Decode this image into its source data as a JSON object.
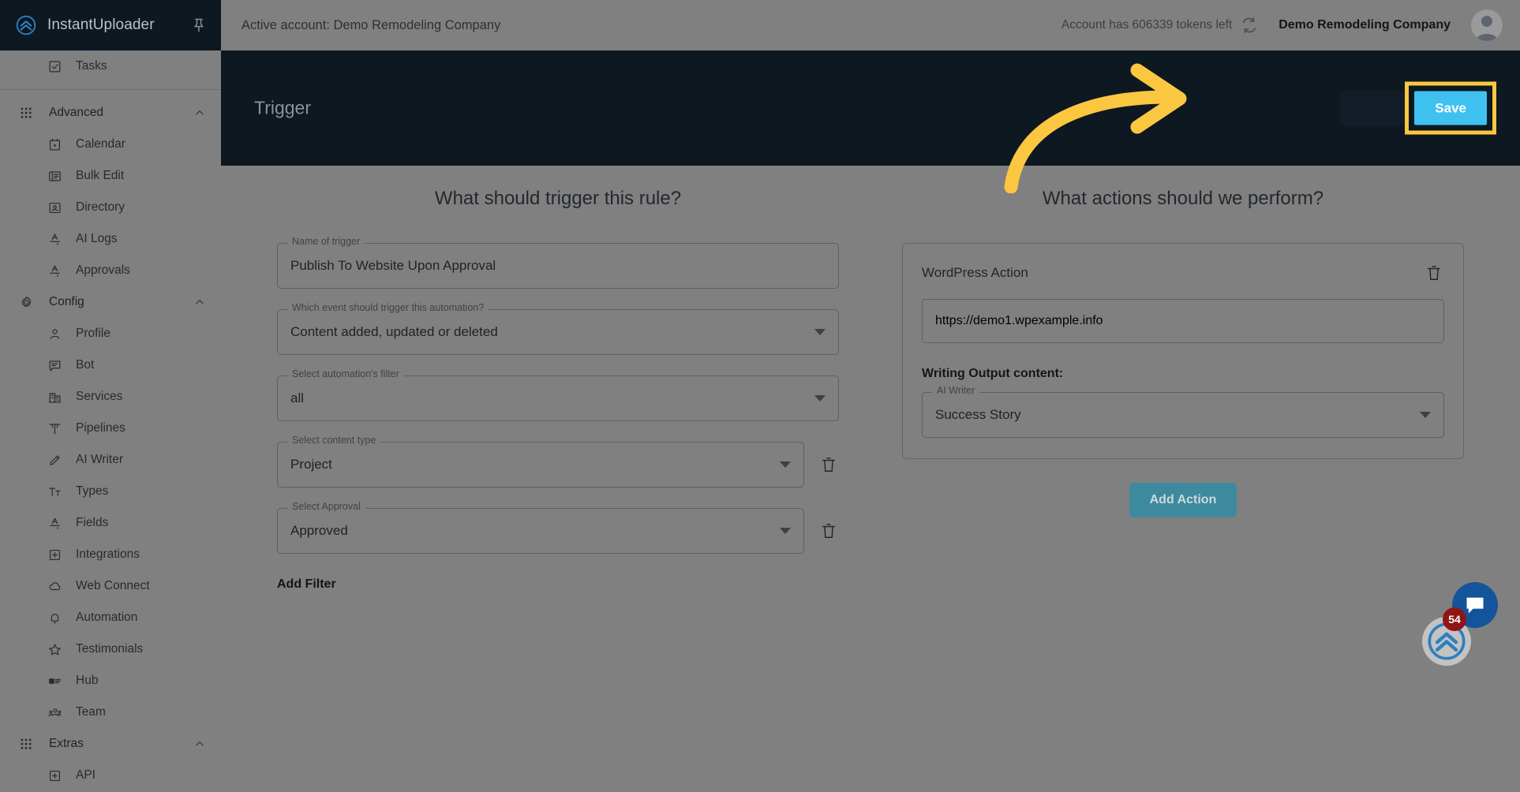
{
  "brand": {
    "name": "InstantUploader",
    "logo_icon": "chevrons-up-circle-icon",
    "pin_icon": "pin-icon"
  },
  "sidebar": {
    "items": [
      {
        "label": "Tasks",
        "icon": "checkbox-icon",
        "type": "leaf"
      },
      {
        "label": "Advanced",
        "icon": "grid-apps-icon",
        "type": "group",
        "caret": "chevron-up-icon"
      },
      {
        "label": "Calendar",
        "icon": "calendar-icon",
        "type": "leaf"
      },
      {
        "label": "Bulk Edit",
        "icon": "list-edit-icon",
        "type": "leaf"
      },
      {
        "label": "Directory",
        "icon": "contact-card-icon",
        "type": "leaf"
      },
      {
        "label": "AI Logs",
        "icon": "text-format-icon",
        "type": "leaf"
      },
      {
        "label": "Approvals",
        "icon": "text-format-icon",
        "type": "leaf"
      },
      {
        "label": "Config",
        "icon": "gear-icon",
        "type": "group",
        "caret": "chevron-up-icon"
      },
      {
        "label": "Profile",
        "icon": "person-icon",
        "type": "leaf"
      },
      {
        "label": "Bot",
        "icon": "chat-lines-icon",
        "type": "leaf"
      },
      {
        "label": "Services",
        "icon": "building-icon",
        "type": "leaf"
      },
      {
        "label": "Pipelines",
        "icon": "pipeline-icon",
        "type": "leaf"
      },
      {
        "label": "AI Writer",
        "icon": "pencil-icon",
        "type": "leaf"
      },
      {
        "label": "Types",
        "icon": "text-size-icon",
        "type": "leaf"
      },
      {
        "label": "Fields",
        "icon": "text-format-icon",
        "type": "leaf"
      },
      {
        "label": "Integrations",
        "icon": "plus-box-icon",
        "type": "leaf"
      },
      {
        "label": "Web Connect",
        "icon": "cloud-icon",
        "type": "leaf"
      },
      {
        "label": "Automation",
        "icon": "bell-icon",
        "type": "leaf"
      },
      {
        "label": "Testimonials",
        "icon": "star-icon",
        "type": "leaf"
      },
      {
        "label": "Hub",
        "icon": "media-list-icon",
        "type": "leaf"
      },
      {
        "label": "Team",
        "icon": "people-icon",
        "type": "leaf"
      },
      {
        "label": "Extras",
        "icon": "grid-apps-icon",
        "type": "group",
        "caret": "chevron-up-icon"
      },
      {
        "label": "API",
        "icon": "plus-box-icon",
        "type": "leaf"
      }
    ]
  },
  "topbar": {
    "active_account": "Active account: Demo Remodeling Company",
    "tokens_text": "Account has 606339 tokens left",
    "refresh_icon": "refresh-icon",
    "company_name": "Demo Remodeling Company",
    "avatar_icon": "avatar-person-icon"
  },
  "page_header": {
    "title": "Trigger",
    "save_label": "Save",
    "highlight_color": "#fbc740",
    "save_color": "#3fc1f0",
    "annotation_icon": "curved-arrow-icon"
  },
  "trigger_panel": {
    "heading": "What should trigger this rule?",
    "name_field": {
      "legend": "Name of trigger",
      "value": "Publish To Website Upon Approval"
    },
    "event_field": {
      "legend": "Which event should trigger this automation?",
      "value": "Content added, updated or deleted",
      "chevron_icon": "chevron-down-icon"
    },
    "filter_field": {
      "legend": "Select automation's filter",
      "value": "all",
      "chevron_icon": "chevron-down-icon"
    },
    "content_type_field": {
      "legend": "Select content type",
      "value": "Project",
      "chevron_icon": "chevron-down-icon",
      "delete_icon": "trash-icon"
    },
    "approval_field": {
      "legend": "Select Approval",
      "value": "Approved",
      "chevron_icon": "chevron-down-icon",
      "delete_icon": "trash-icon"
    },
    "add_filter_label": "Add Filter"
  },
  "actions_panel": {
    "heading": "What actions should we perform?",
    "action_card": {
      "title": "WordPress Action",
      "delete_icon": "trash-icon",
      "site_field": {
        "value": "https://demo1.wpexample.info",
        "chevron_icon": "chevron-down-icon"
      },
      "writing_output_label": "Writing Output content:",
      "ai_writer_field": {
        "legend": "AI Writer",
        "value": "Success Story",
        "chevron_icon": "chevron-down-icon"
      }
    },
    "add_action_label": "Add Action",
    "add_action_color": "#3d8a9e"
  },
  "widgets": {
    "chat_icon": "chat-bubble-icon",
    "chat_color": "#14549b",
    "launcher_icon": "chevrons-up-circle-icon",
    "badge_count": "54",
    "badge_color": "#8f1616"
  }
}
